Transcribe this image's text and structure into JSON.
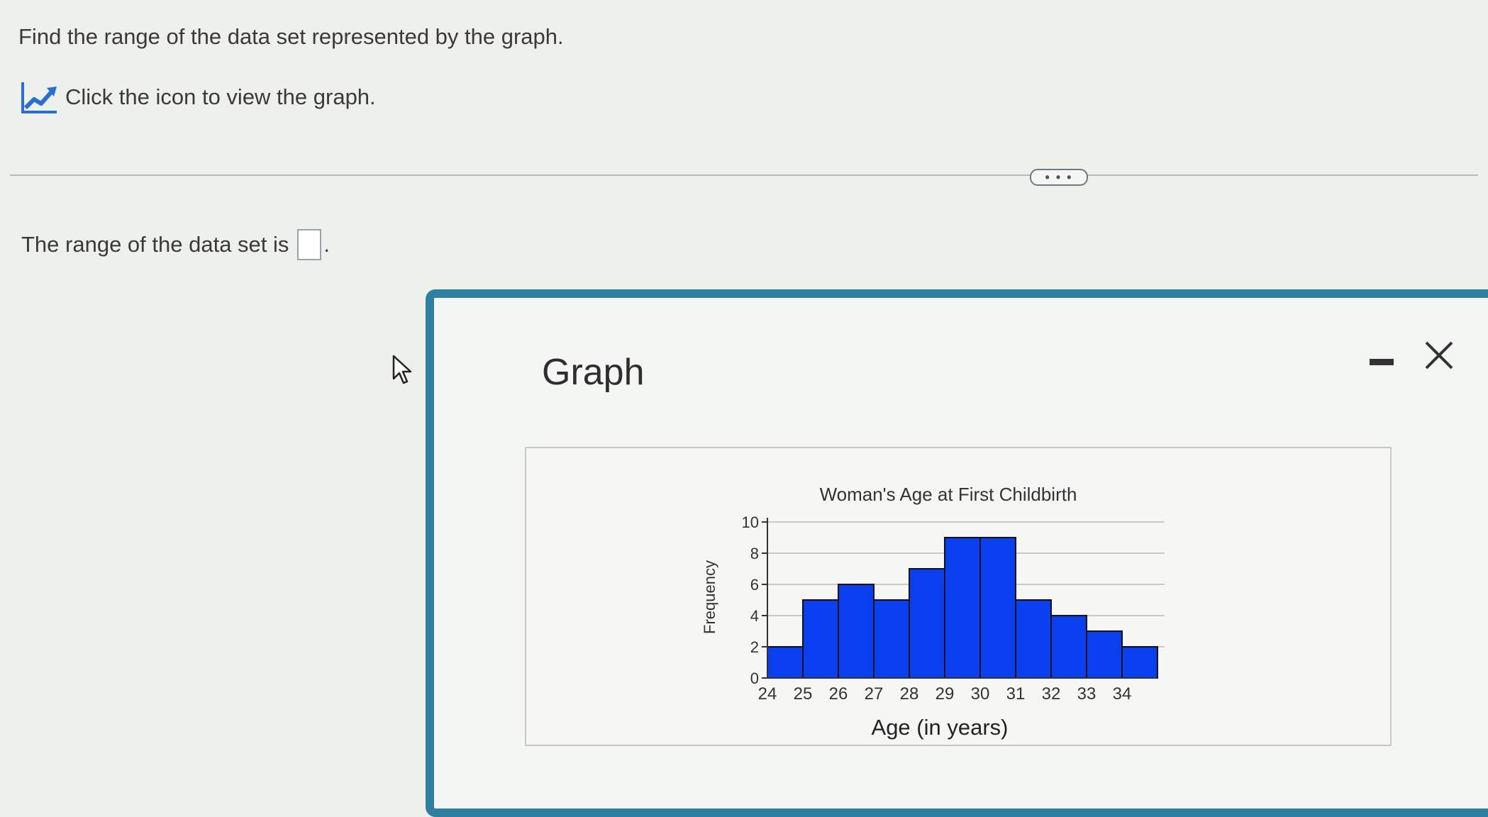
{
  "question": {
    "prompt": "Find the range of the data set represented by the graph.",
    "graph_link_text": "Click the icon to view the graph."
  },
  "more_button": {
    "label": "• • •"
  },
  "answer": {
    "prefix": "The range of the data set is",
    "value": "",
    "suffix": "."
  },
  "popup": {
    "title": "Graph",
    "border_color": "#2f7fa0"
  },
  "icons": {
    "graph": "line-chart-icon",
    "minimize": "minimize-icon",
    "close": "close-icon",
    "cursor": "mouse-pointer-icon"
  },
  "chart_data": {
    "type": "bar",
    "title": "Woman's Age at First Childbirth",
    "xlabel": "Age (in years)",
    "ylabel": "Frequency",
    "categories": [
      "24",
      "25",
      "26",
      "27",
      "28",
      "29",
      "30",
      "31",
      "32",
      "33",
      "34"
    ],
    "values": [
      2,
      5,
      6,
      5,
      7,
      9,
      9,
      5,
      4,
      3,
      2
    ],
    "ylim": [
      0,
      10
    ],
    "yticks": [
      "0",
      "2",
      "4",
      "6",
      "8",
      "10"
    ],
    "grid": true,
    "bar_color": "#0a3ff0"
  }
}
